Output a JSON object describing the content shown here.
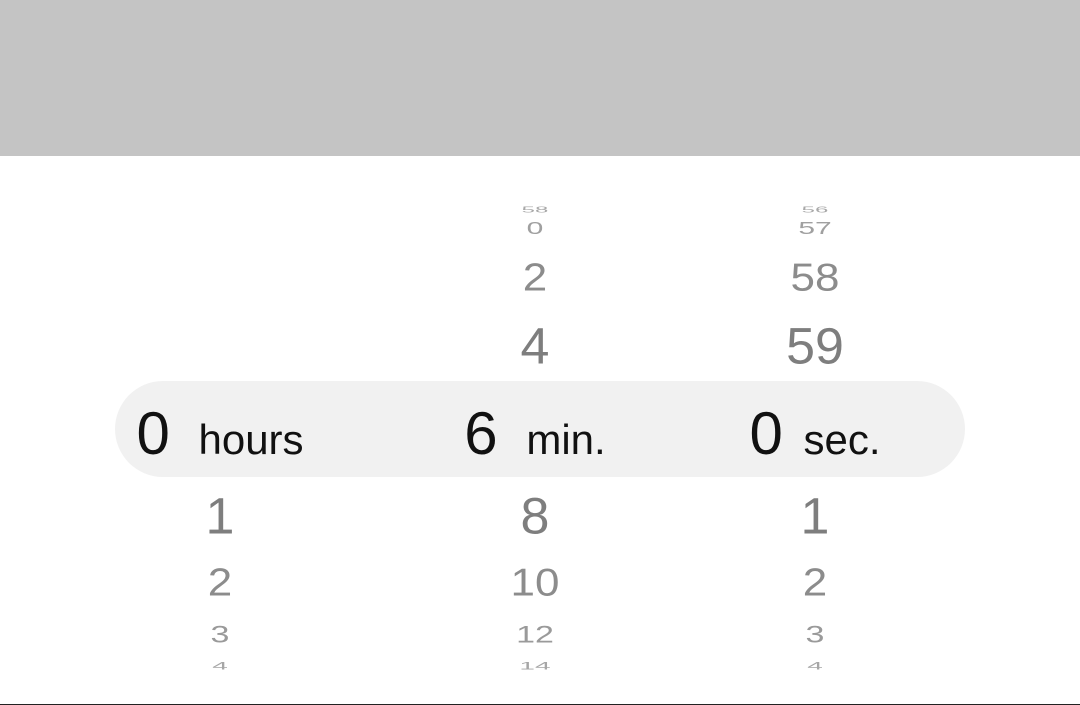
{
  "top": {},
  "picker": {
    "hours": {
      "selected_value": "0",
      "unit_label": "hours",
      "below": [
        "1",
        "2",
        "3",
        "4"
      ]
    },
    "minutes": {
      "above": [
        "58",
        "0",
        "2",
        "4"
      ],
      "selected_value": "6",
      "unit_label": "min.",
      "below": [
        "8",
        "10",
        "12",
        "14"
      ]
    },
    "seconds": {
      "above": [
        "56",
        "57",
        "58",
        "59"
      ],
      "selected_value": "0",
      "unit_label": "sec.",
      "below": [
        "1",
        "2",
        "3",
        "4"
      ]
    }
  }
}
